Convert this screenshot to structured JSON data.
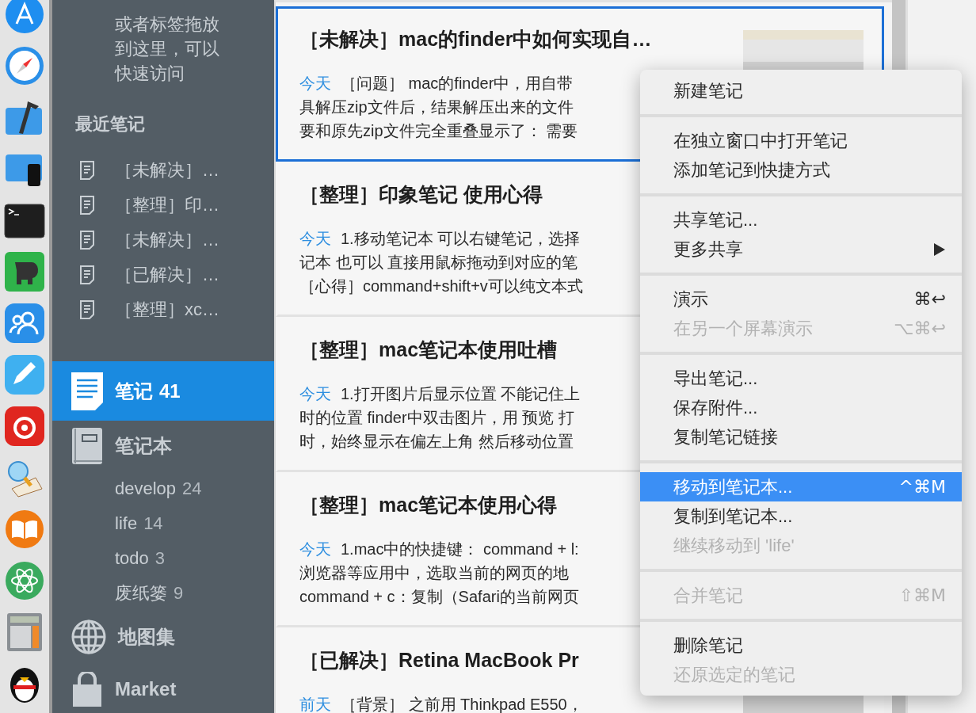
{
  "sidebar": {
    "shortcuts_hint": "或者标签拖放到这里，可以快速访问",
    "recent_notes": {
      "title": "最近笔记",
      "items": [
        {
          "title": "［未解决］…"
        },
        {
          "title": "［整理］印…"
        },
        {
          "title": "［未解决］…"
        },
        {
          "title": "［已解决］…"
        },
        {
          "title": "［整理］xc…"
        }
      ]
    },
    "nav": [
      {
        "kind": "notes",
        "label": "笔记",
        "count": "41",
        "selected": true
      },
      {
        "kind": "notebooks",
        "label": "笔记本",
        "selected": false,
        "children": [
          {
            "label": "develop",
            "count": "24"
          },
          {
            "label": "life",
            "count": "14"
          },
          {
            "label": "todo",
            "count": "3"
          },
          {
            "label": "废纸篓",
            "count": "9"
          }
        ]
      },
      {
        "kind": "atlas",
        "label": "地图集",
        "selected": false
      },
      {
        "kind": "market",
        "label": "Market",
        "selected": false
      }
    ]
  },
  "notes": [
    {
      "title": "［未解决］mac的finder中如何实现自…",
      "date": "今天",
      "lines": [
        "［问题］ mac的finder中，用自带",
        "具解压zip文件后，结果解压出来的文件",
        "要和原先zip文件完全重叠显示了： 需要"
      ],
      "selected": true,
      "has_thumbnail": true
    },
    {
      "title": "［整理］印象笔记 使用心得",
      "date": "今天",
      "lines": [
        "1.移动笔记本 可以右键笔记，选择",
        "记本 也可以 直接用鼠标拖动到对应的笔",
        "［心得］command+shift+v可以纯文本式"
      ],
      "selected": false
    },
    {
      "title": "［整理］mac笔记本使用吐槽",
      "date": "今天",
      "lines": [
        "1.打开图片后显示位置 不能记住上",
        "时的位置 finder中双击图片，用 预览 打",
        "时，始终显示在偏左上角 然后移动位置"
      ],
      "selected": false
    },
    {
      "title": "［整理］mac笔记本使用心得",
      "date": "今天",
      "lines": [
        "1.mac中的快捷键： command + l:",
        "浏览器等应用中，选取当前的网页的地",
        "command + c：复制（Safari的当前网页"
      ],
      "selected": false
    },
    {
      "title": "［已解决］Retina MacBook Pr",
      "date": "前天",
      "lines": [
        "［背景］ 之前用 Thinkpad E550，"
      ],
      "selected": false,
      "has_thumbnail": true
    }
  ],
  "context_menu": {
    "groups": [
      {
        "items": [
          {
            "label": "新建笔记",
            "disabled": false,
            "selected": false,
            "has_submenu": false
          }
        ]
      },
      {
        "items": [
          {
            "label": "在独立窗口中打开笔记",
            "disabled": false,
            "selected": false,
            "has_submenu": false
          },
          {
            "label": "添加笔记到快捷方式",
            "disabled": false,
            "selected": false,
            "has_submenu": false
          }
        ]
      },
      {
        "items": [
          {
            "label": "共享笔记...",
            "disabled": false,
            "selected": false,
            "has_submenu": false
          },
          {
            "label": "更多共享",
            "disabled": false,
            "selected": false,
            "has_submenu": true
          }
        ]
      },
      {
        "items": [
          {
            "label": "演示",
            "shortcut": "⌘↩",
            "disabled": false,
            "selected": false,
            "has_submenu": false
          },
          {
            "label": "在另一个屏幕演示",
            "shortcut": "⌥⌘↩",
            "disabled": true,
            "selected": false,
            "has_submenu": false
          }
        ]
      },
      {
        "items": [
          {
            "label": "导出笔记...",
            "disabled": false,
            "selected": false,
            "has_submenu": false
          },
          {
            "label": "保存附件...",
            "disabled": false,
            "selected": false,
            "has_submenu": false
          },
          {
            "label": "复制笔记链接",
            "disabled": false,
            "selected": false,
            "has_submenu": false
          }
        ]
      },
      {
        "items": [
          {
            "label": "移动到笔记本...",
            "shortcut": "^⌘M",
            "disabled": false,
            "selected": true,
            "has_submenu": false
          },
          {
            "label": "复制到笔记本...",
            "disabled": false,
            "selected": false,
            "has_submenu": false
          },
          {
            "label": "继续移动到 'life'",
            "disabled": true,
            "selected": false,
            "has_submenu": false
          }
        ]
      },
      {
        "items": [
          {
            "label": "合并笔记",
            "shortcut": "⇧⌘M",
            "disabled": true,
            "selected": false,
            "has_submenu": false
          }
        ]
      },
      {
        "items": [
          {
            "label": "删除笔记",
            "disabled": false,
            "selected": false,
            "has_submenu": false
          },
          {
            "label": "还原选定的笔记",
            "disabled": true,
            "selected": false,
            "has_submenu": false
          }
        ]
      }
    ]
  }
}
